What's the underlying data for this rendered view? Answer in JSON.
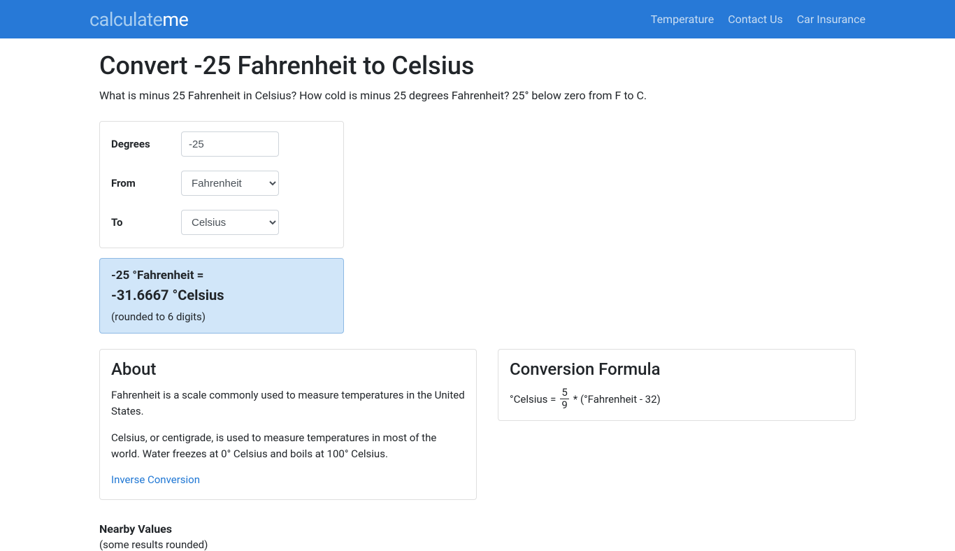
{
  "brand": {
    "part1": "calculate",
    "part2": "me"
  },
  "nav": {
    "temperature": "Temperature",
    "contact": "Contact Us",
    "insurance": "Car Insurance"
  },
  "page": {
    "title": "Convert -25 Fahrenheit to Celsius",
    "lead": "What is minus 25 Fahrenheit in Celsius? How cold is minus 25 degrees Fahrenheit? 25° below zero from F to C."
  },
  "form": {
    "degrees_label": "Degrees",
    "degrees_value": "-25",
    "from_label": "From",
    "from_value": "Fahrenheit",
    "to_label": "To",
    "to_value": "Celsius"
  },
  "result": {
    "line1": "-25 °Fahrenheit =",
    "line2": "-31.6667 °Celsius",
    "rounded": "(rounded to 6 digits)"
  },
  "about": {
    "heading": "About",
    "p1": "Fahrenheit is a scale commonly used to measure temperatures in the United States.",
    "p2": "Celsius, or centigrade, is used to measure temperatures in most of the world. Water freezes at 0° Celsius and boils at 100° Celsius.",
    "inverse_link": "Inverse Conversion"
  },
  "formula": {
    "heading": "Conversion Formula",
    "lhs": "°Celsius = ",
    "num": "5",
    "den": "9",
    "rhs": " * (°Fahrenheit - 32)"
  },
  "nearby": {
    "title": "Nearby Values",
    "sub": "(some results rounded)"
  }
}
